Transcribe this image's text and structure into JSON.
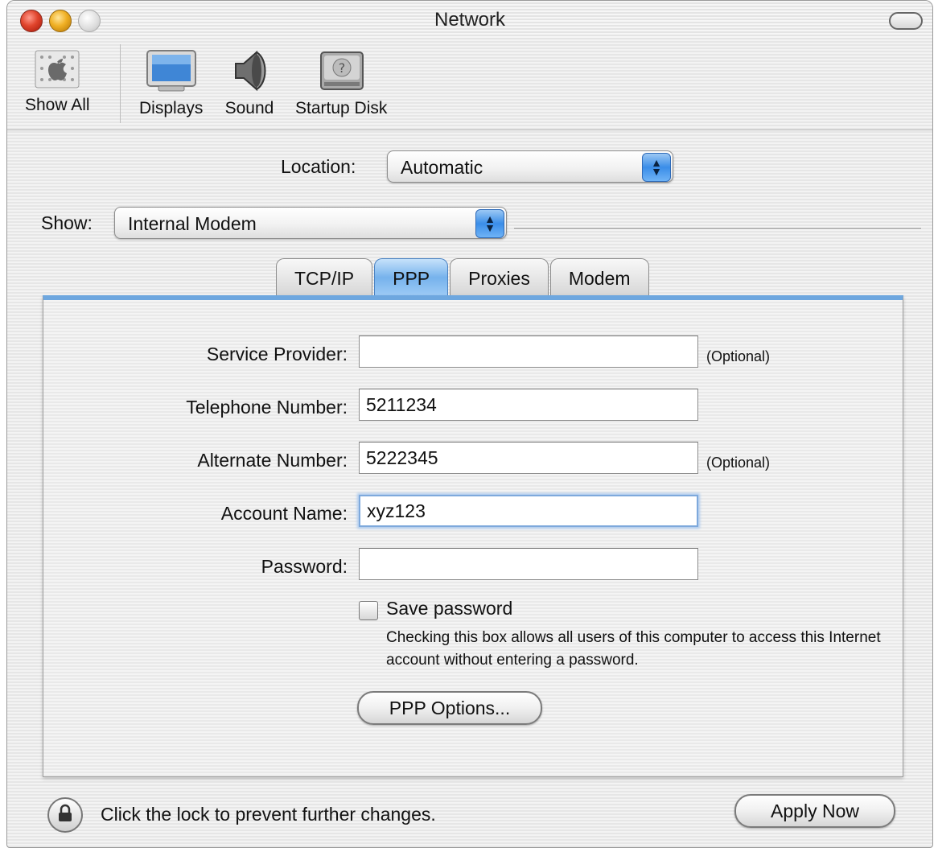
{
  "window": {
    "title": "Network"
  },
  "toolbar": {
    "items": [
      {
        "label": "Show All",
        "icon": "apple-logo-icon"
      },
      {
        "label": "Displays",
        "icon": "display-icon"
      },
      {
        "label": "Sound",
        "icon": "speaker-icon"
      },
      {
        "label": "Startup Disk",
        "icon": "hard-disk-icon"
      }
    ]
  },
  "location": {
    "label": "Location:",
    "value": "Automatic"
  },
  "show": {
    "label": "Show:",
    "value": "Internal Modem"
  },
  "tabs": [
    {
      "label": "TCP/IP",
      "active": false
    },
    {
      "label": "PPP",
      "active": true
    },
    {
      "label": "Proxies",
      "active": false
    },
    {
      "label": "Modem",
      "active": false
    }
  ],
  "form": {
    "service_provider": {
      "label": "Service Provider:",
      "value": "",
      "note": "(Optional)"
    },
    "telephone_number": {
      "label": "Telephone Number:",
      "value": "5211234"
    },
    "alternate_number": {
      "label": "Alternate Number:",
      "value": "5222345",
      "note": "(Optional)"
    },
    "account_name": {
      "label": "Account Name:",
      "value": "xyz123"
    },
    "password": {
      "label": "Password:",
      "value": ""
    },
    "save_password": {
      "label": "Save password",
      "checked": false,
      "help": "Checking this box allows all users of this computer to access this Internet account without entering a password."
    },
    "ppp_options_button": "PPP Options..."
  },
  "footer": {
    "lock_text": "Click the lock to prevent further changes.",
    "apply_button": "Apply Now"
  },
  "colors": {
    "accent": "#3a8de8",
    "close": "#e0442c",
    "minimize": "#f0b024"
  }
}
